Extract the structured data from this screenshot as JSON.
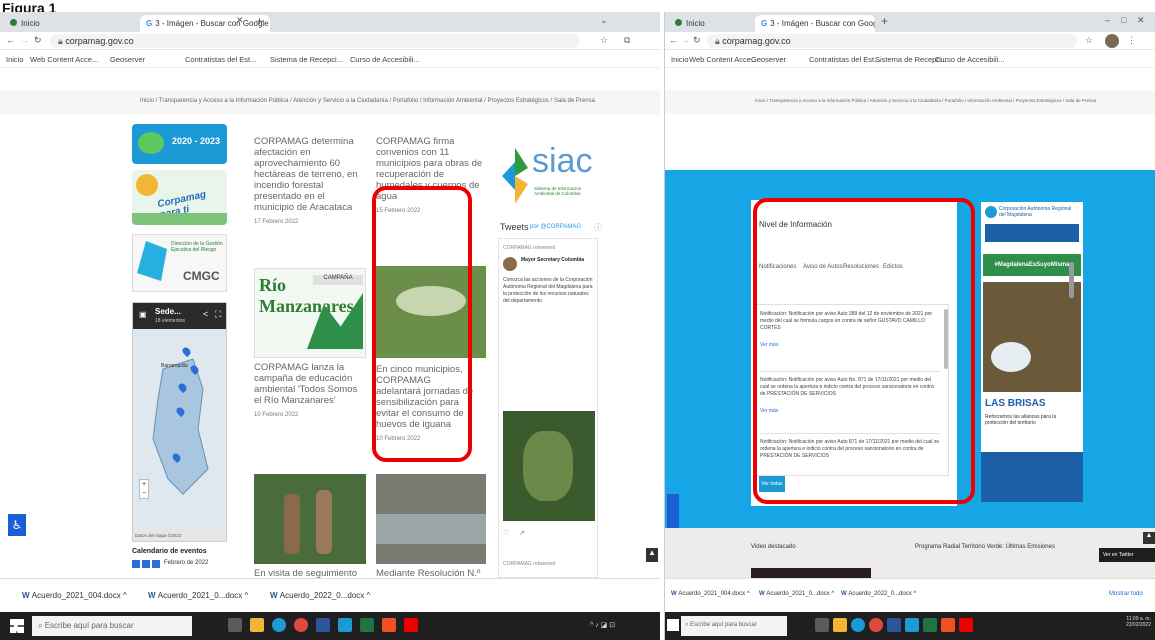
{
  "figure_label": "Figura 1",
  "left": {
    "tabs": [
      "Inicio",
      "3 - Imágen - Buscar con Google"
    ],
    "url": "corpamag.gov.co",
    "bookmarks": [
      "Inicio",
      "Web Content Acce...",
      "Geoserver",
      "Contratistas del Est...",
      "Sistema de Recepci...",
      "Curso de Accesibili..."
    ],
    "breadcrumb": "Inicio / Transparencia y Acceso a la Información Pública / Atención y Servicio a la Ciudadanía / Portafolio / Información Ambiental / Proyectos Estratégicos / Sala de Prensa",
    "banner1_text": "2020 - 2023",
    "banner2_text": "Corpamag para ti",
    "banner3_text": "CMGC",
    "banner3_caption": "Dirección de la Gestión Ejecutiva del Riesgo",
    "news1": {
      "text": "CORPAMAG determina afectación en aprovechamiento 60 hectáreas de terreno, en incendio forestal presentado en el municipio de Aracataca",
      "date": "17 Febrero 2022"
    },
    "news2": {
      "text": "CORPAMAG firma convenios con 11 municipios para obras de recuperación de humedales y cuerpos de agua",
      "date": "15 Febrero 2022"
    },
    "news3": {
      "text": "CORPAMAG lanza la campaña de educación ambiental 'Todos Somos el Río Manzanares'",
      "date": "10 Febrero 2022"
    },
    "news4": {
      "text": "En cinco municipios, CORPAMAG adelantará jornadas de sensibilización para evitar el consumo de huevos de iguana",
      "date": "10 Febrero 2022"
    },
    "news5": {
      "text": "En visita de seguimiento"
    },
    "news6": {
      "text": "Mediante Resolución N.º"
    },
    "campaign_label": "CAMPAÑA",
    "campaign_title": "Río Manzanares",
    "siac_title": "siac",
    "siac_subtitle": "Sistema de Información Ambiental de Colombia",
    "tweets_header": "Tweets",
    "tweets_by": "por @CORPAMAG",
    "tweet_author": "Mayor Secretary Colombia",
    "tweet_body": "Conozca las acciones de la Corporación Autónoma Regional del Magdalena para la protección de los recursos naturales del departamento",
    "tweet_retweeted": "CORPAMAG retweeted",
    "map_title": "Sede...",
    "map_subtitle": "18 elementos",
    "map_city": "Barranquilla",
    "map_footer": "Datos del mapa ©2022",
    "calendar_title": "Calendario de eventos",
    "calendar_month": "Febrero de 2022",
    "downloads": [
      "Acuerdo_2021_004.docx",
      "Acuerdo_2021_0...docx",
      "Acuerdo_2022_0...docx"
    ],
    "search_placeholder": "Escribe aquí para buscar"
  },
  "right": {
    "tabs": [
      "Inicio",
      "3 - Imágen - Buscar con Google"
    ],
    "url": "corpamag.gov.co",
    "bookmarks": [
      "Inicio",
      "Web Content Acce...",
      "Geoserver",
      "Contratistas del Est...",
      "Sistema de Recepci...",
      "Curso de Accesibili..."
    ],
    "breadcrumb": "Inicio / Transparencia y Acceso a la Información Pública / Atención y Servicio a la Ciudadanía / Portafolio / Información Ambiental / Proyectos Estratégicos / Sala de Prensa",
    "info_title": "Nivel de Información",
    "info_tabs": [
      "Notificaciones",
      "Aviso de Autos",
      "Resoluciones",
      "Edictos"
    ],
    "notices": [
      {
        "text": "Notificación: Notificación por aviso Auto 389 del 12 de noviembre de 2021 por medio del cual se formula cargos en contra de señor GUSTAVO CAMILLO CORTÉS",
        "link": "Ver más"
      },
      {
        "text": "Notificación: Notificación por aviso Auto No. 871 de 17/11/2021 por medio del cual se ordena la apertura e indicio contra del proceso sancionatorio en contra de PRESTACIÓN DE SERVICIOS",
        "link": "Ver más"
      },
      {
        "text": "Notificación: Notificación por aviso Auto 871 de 17/11/2021 por medio del cual se ordena la apertura e indicio contra del proceso sancionatorio en contra de PRESTACIÓN DE SERVICIOS",
        "link": "Ver más"
      }
    ],
    "see_more_button": "Ver todas",
    "poster_title": "Corporación Autónoma Regional del Magdalena",
    "poster_hashtag": "#MagdalenaEsSuyoMisma",
    "poster_place": "LAS BRISAS",
    "poster_sub": "Reforzamos las alianzas para la protección del territorio",
    "footer_left": "Video destacado",
    "footer_right": "Programa Radial Territorio Verde: Últimas Emisiones",
    "side_button": "Ver en Twitter",
    "downloads": [
      "Acuerdo_2021_004.docx",
      "Acuerdo_2021_0...docx",
      "Acuerdo_2022_0...docx"
    ],
    "show_all": "Mostrar todo",
    "search_placeholder": "Escribe aquí para buscar",
    "clock_time": "11:09 a. m.",
    "clock_date": "22/02/2022"
  },
  "colors": {
    "highlight": "#e00000",
    "brand_green": "#2e7d32",
    "page_blue": "#16a6e6",
    "taskbar": "#1f1f1f"
  }
}
